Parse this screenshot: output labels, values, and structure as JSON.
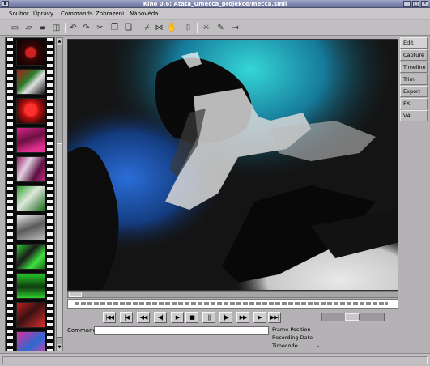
{
  "window": {
    "title": "Kino 0.6: Atata_Umecca_projekce/mecca.smil"
  },
  "menubar": {
    "items": [
      "Soubor",
      "Úpravy",
      "Commands",
      "Zobrazení",
      "Nápověda"
    ]
  },
  "toolbar": {
    "icons": [
      "new-document-icon",
      "open-icon",
      "save-icon",
      "save-as-icon",
      "undo-icon",
      "redo-icon",
      "cut-icon",
      "copy-icon",
      "paste-icon",
      "split-scene-icon",
      "join-icon",
      "hand-icon",
      "clip-icon",
      "preferences-icon",
      "eraser-icon",
      "exit-icon"
    ]
  },
  "sidetabs": {
    "items": [
      "Edit",
      "Capture",
      "Timeline",
      "Trim",
      "Export",
      "FX",
      "V4L"
    ],
    "active": "Edit"
  },
  "transport": {
    "buttons": [
      {
        "name": "start-button",
        "glyph": "|◀◀"
      },
      {
        "name": "prev-scene-button",
        "glyph": "|◀"
      },
      {
        "name": "rewind-button",
        "glyph": "◀◀"
      },
      {
        "name": "back-frame-button",
        "glyph": "◀|"
      },
      {
        "name": "play-button",
        "glyph": "▶"
      },
      {
        "name": "stop-button",
        "glyph": "■"
      },
      {
        "name": "pause-button",
        "glyph": "||"
      },
      {
        "name": "forward-frame-button",
        "glyph": "|▶"
      },
      {
        "name": "fast-forward-button",
        "glyph": "▶▶"
      },
      {
        "name": "next-scene-button",
        "glyph": "▶|"
      },
      {
        "name": "end-button",
        "glyph": "▶▶|"
      }
    ]
  },
  "command": {
    "label": "Command",
    "value": ""
  },
  "info": {
    "frame_position": {
      "label": "Frame Position",
      "value": "-"
    },
    "recording_date": {
      "label": "Recording Date",
      "value": "-"
    },
    "timecode": {
      "label": "Timecode",
      "value": "-"
    }
  },
  "colors": {
    "titlebar": "#7d84ae",
    "window_bg": "#b4b2b4",
    "filmstrip": "#0a0a0a"
  }
}
